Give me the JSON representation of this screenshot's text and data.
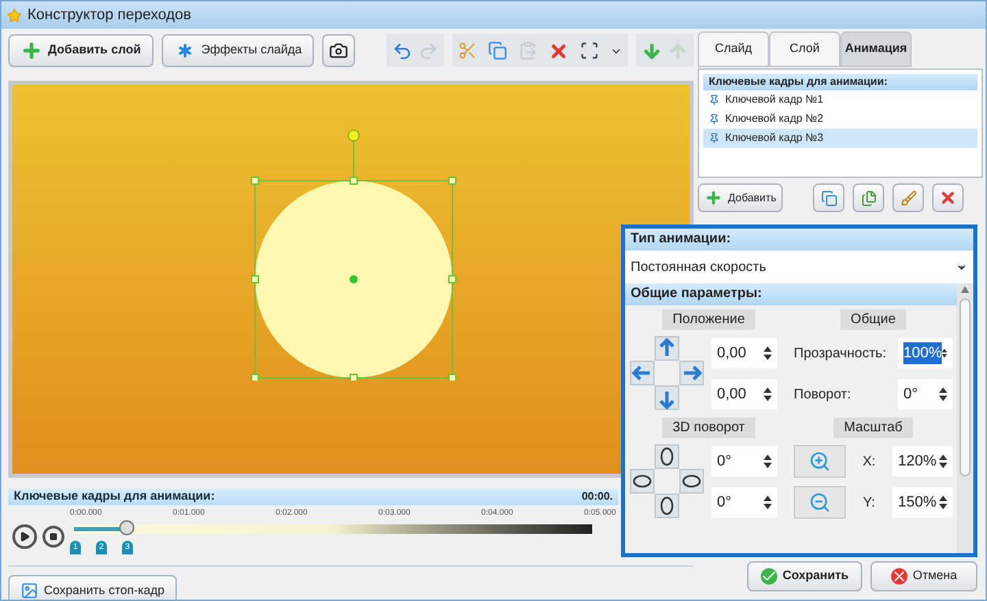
{
  "window": {
    "title": "Конструктор переходов"
  },
  "toolbar": {
    "buttons": [
      {
        "kind": "add",
        "label": "Добавить слой"
      },
      {
        "kind": "effects",
        "label": "Эффекты слайда"
      }
    ],
    "undo_disabled": false,
    "redo_disabled": true,
    "paste_disabled": true,
    "move_up_disabled": true
  },
  "tabs": [
    {
      "label": "Слайд",
      "selected": false
    },
    {
      "label": "Слой",
      "selected": false
    },
    {
      "label": "Анимация",
      "selected": true
    }
  ],
  "keyframes_panel": {
    "title": "Ключевые кадры для анимации:",
    "items": [
      {
        "label": "Ключевой кадр №1",
        "selected": false
      },
      {
        "label": "Ключевой кадр №2",
        "selected": false
      },
      {
        "label": "Ключевой кадр №3",
        "selected": true
      }
    ],
    "add_button": "Добавить"
  },
  "timeline": {
    "title": "Ключевые кадры для анимации:",
    "time": "00:00.",
    "ticks": [
      "0:00.000",
      "0:01.000",
      "0:02.000",
      "0:03.000",
      "0:04.000",
      "0:05.000"
    ],
    "level": 0.1,
    "markers": [
      "1",
      "2",
      "3"
    ]
  },
  "save_frame_button": "Сохранить стоп-кадр",
  "animation_panel": {
    "title": "Тип анимации:",
    "type_value": "Постоянная скорость",
    "params_title": "Общие параметры:",
    "position": {
      "title": "Положение",
      "values": [
        "0,00",
        "0,00"
      ]
    },
    "general": {
      "title": "Общие",
      "fields": [
        {
          "label": "Прозрачность:",
          "value": "100%",
          "highlighted": true
        },
        {
          "label": "Поворот:",
          "value": "0°",
          "highlighted": false
        }
      ]
    },
    "rotation_3d": {
      "title": "3D поворот",
      "values": [
        "0°",
        "0°"
      ]
    },
    "scale": {
      "title": "Масштаб",
      "fields": [
        {
          "label": "X:",
          "value": "120%"
        },
        {
          "label": "Y:",
          "value": "150%"
        }
      ]
    }
  },
  "footer": {
    "save": "Сохранить",
    "cancel": "Отмена"
  }
}
